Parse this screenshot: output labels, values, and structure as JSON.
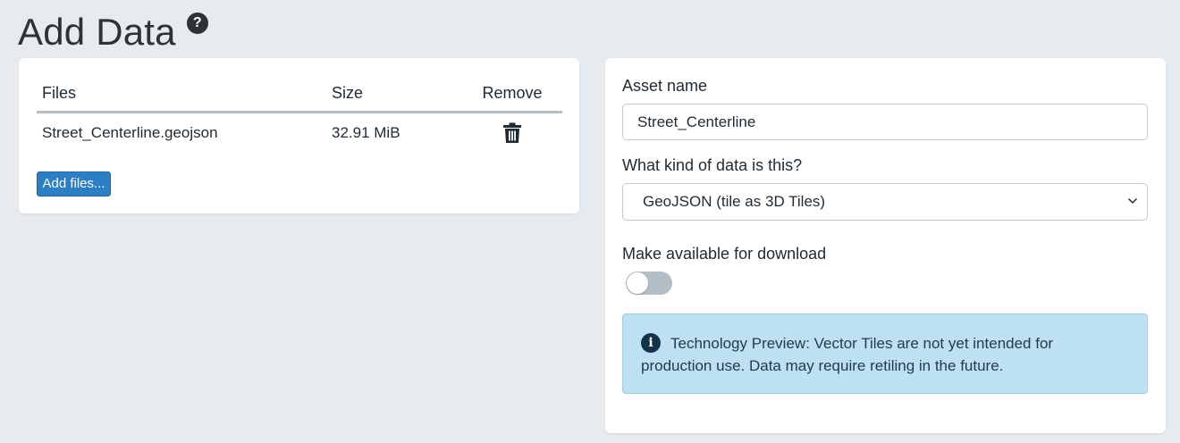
{
  "header": {
    "title": "Add Data",
    "help_icon_glyph": "?",
    "help_icon": "question-circle-icon"
  },
  "files_panel": {
    "columns": {
      "name": "Files",
      "size": "Size",
      "remove": "Remove"
    },
    "rows": [
      {
        "name": "Street_Centerline.geojson",
        "size": "32.91 MiB",
        "remove_icon": "trash-icon"
      }
    ],
    "add_files_label": "Add files..."
  },
  "form": {
    "asset_name_label": "Asset name",
    "asset_name_value": "Street_Centerline",
    "data_kind_label": "What kind of data is this?",
    "data_kind_selected": "GeoJSON (tile as 3D Tiles)",
    "download_label": "Make available for download",
    "download_enabled": false,
    "info_icon_glyph": "i",
    "info_text": "Technology Preview: Vector Tiles are not yet intended for production use. Data may require retiling in the future."
  },
  "colors": {
    "page_background": "#e5ebee",
    "card_background": "#ffffff",
    "primary_button": "#2b7fc4",
    "info_background": "#bde0f4",
    "toggle_off": "#b3bec6"
  }
}
